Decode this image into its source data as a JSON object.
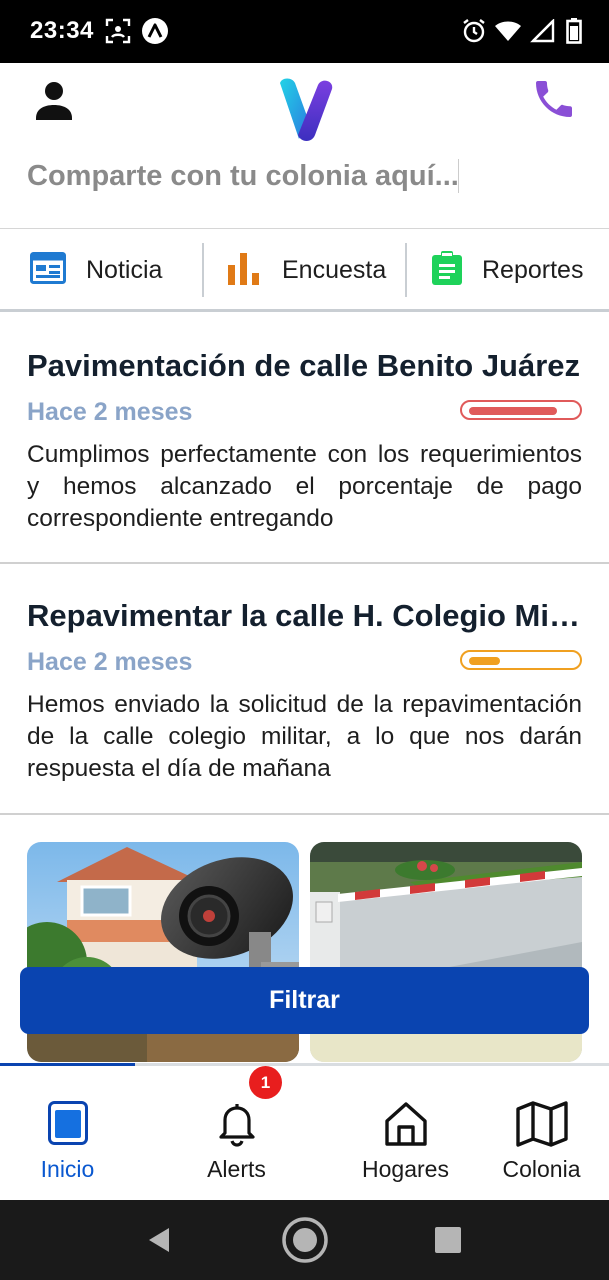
{
  "status_bar": {
    "time": "23:34"
  },
  "header": {
    "share_placeholder": "Comparte con tu colonia aquí..."
  },
  "actions": [
    {
      "label": "Noticia",
      "icon": "news-icon",
      "color": "#1f7ad1"
    },
    {
      "label": "Encuesta",
      "icon": "bar-chart-icon",
      "color": "#e07a16"
    },
    {
      "label": "Reportes",
      "icon": "clipboard-icon",
      "color": "#1ed25a"
    }
  ],
  "news": [
    {
      "title": "Pavimentación de calle Benito Juárez",
      "time": "Hace 2 meses",
      "description": "Cumplimos perfectamente con los requerimientos y hemos alcanzado el porcentaje de pago correspondiente entregando",
      "progress": 0.85,
      "progress_color": "#e05a5a"
    },
    {
      "title": "Repavimentar la calle H. Colegio Militar",
      "time": "Hace 2 meses",
      "description": "Hemos enviado la solicitud de la repavimentación de la calle colegio militar, a lo que nos darán respuesta el día de mañana",
      "progress": 0.3,
      "progress_color": "#f0a020"
    }
  ],
  "filter_button": "Filtrar",
  "bottom_nav": {
    "items": [
      {
        "label": "Inicio",
        "icon": "home-card-icon",
        "active": true
      },
      {
        "label": "Alerts",
        "icon": "bell-icon",
        "badge": "1"
      },
      {
        "label": "Hogares",
        "icon": "house-icon"
      },
      {
        "label": "Colonia",
        "icon": "map-icon"
      }
    ]
  },
  "colors": {
    "primary": "#0a44b0",
    "muted_blue": "#8aa4c8",
    "phone": "#8a4fd6"
  }
}
